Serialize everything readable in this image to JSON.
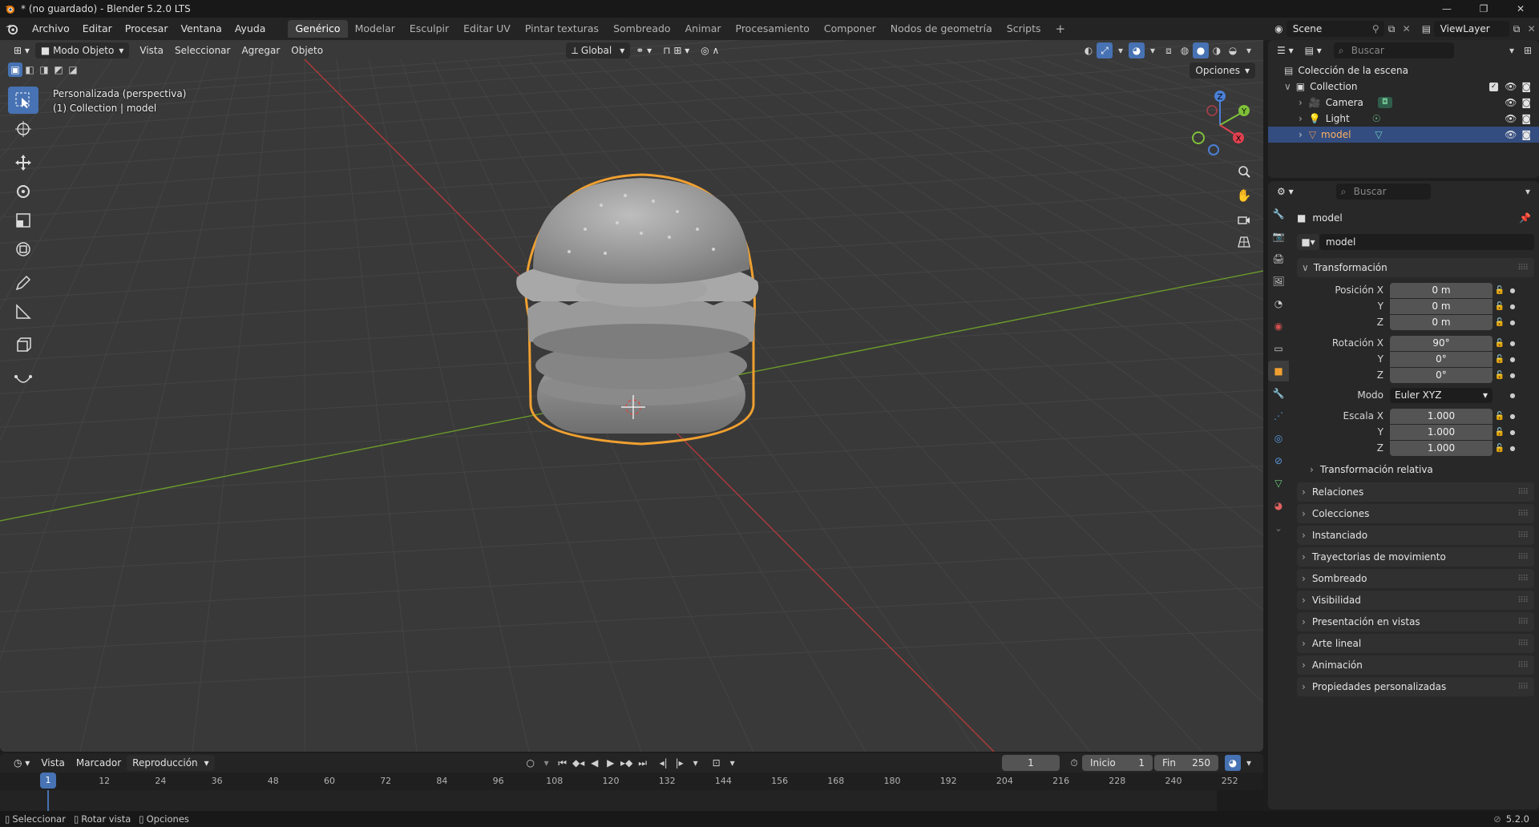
{
  "window": {
    "title": "* (no guardado) - Blender 5.2.0 LTS",
    "controls": [
      "—",
      "❐",
      "✕"
    ]
  },
  "menu": [
    "Archivo",
    "Editar",
    "Procesar",
    "Ventana",
    "Ayuda"
  ],
  "workspaces": [
    "Genérico",
    "Modelar",
    "Esculpir",
    "Editar UV",
    "Pintar texturas",
    "Sombreado",
    "Animar",
    "Procesamiento",
    "Componer",
    "Nodos de geometría",
    "Scripts"
  ],
  "active_workspace": "Genérico",
  "scene": {
    "name": "Scene",
    "view_layer": "ViewLayer"
  },
  "viewport_header": {
    "mode": "Modo Objeto",
    "menus": [
      "Vista",
      "Seleccionar",
      "Agregar",
      "Objeto"
    ],
    "orientation": "Global",
    "options": "Opciones"
  },
  "viewport_info": {
    "line1": "Personalizada (perspectiva)",
    "line2": "(1) Collection | model"
  },
  "gizmo": {
    "x": "X",
    "y": "Y",
    "z": "Z"
  },
  "outliner": {
    "search_placeholder": "Buscar",
    "root": "Colección de la escena",
    "collection": "Collection",
    "items": [
      {
        "name": "Camera"
      },
      {
        "name": "Light"
      },
      {
        "name": "model"
      }
    ]
  },
  "properties": {
    "search_placeholder": "Buscar",
    "object_name": "model",
    "object_field": "model",
    "transform_title": "Transformación",
    "position_label": "Posición X",
    "rotation_label": "Rotación X",
    "scale_label": "Escala X",
    "axis_y": "Y",
    "axis_z": "Z",
    "mode_label": "Modo",
    "position": [
      "0 m",
      "0 m",
      "0 m"
    ],
    "rotation": [
      "90°",
      "0°",
      "0°"
    ],
    "rotation_mode": "Euler XYZ",
    "scale": [
      "1.000",
      "1.000",
      "1.000"
    ],
    "delta_transform": "Transformación relativa",
    "panels": [
      "Relaciones",
      "Colecciones",
      "Instanciado",
      "Trayectorias de movimiento",
      "Sombreado",
      "Visibilidad",
      "Presentación en vistas",
      "Arte lineal",
      "Animación",
      "Propiedades personalizadas"
    ]
  },
  "timeline": {
    "menus": [
      "Vista",
      "Marcador"
    ],
    "playback": "Reproducción",
    "current_frame": "1",
    "start_label": "Inicio",
    "start": "1",
    "end_label": "Fin",
    "end": "250",
    "ticks": [
      "12",
      "24",
      "36",
      "48",
      "60",
      "72",
      "84",
      "96",
      "108",
      "120",
      "132",
      "144",
      "156",
      "168",
      "180",
      "192",
      "204",
      "216",
      "228",
      "240",
      "252"
    ],
    "playhead": "1"
  },
  "statusbar": {
    "items": [
      "Seleccionar",
      "Rotar vista",
      "Opciones"
    ],
    "version": "5.2.0"
  }
}
